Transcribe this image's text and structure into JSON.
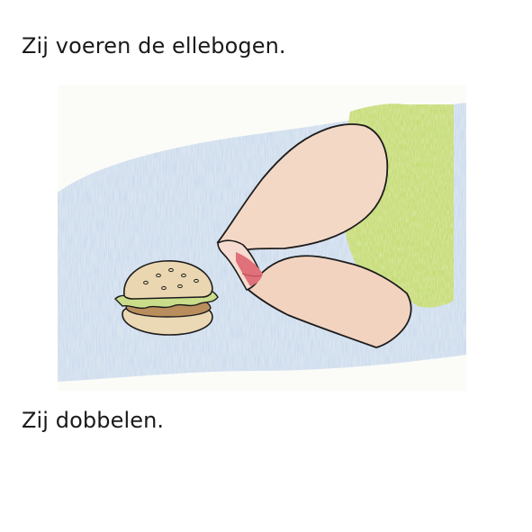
{
  "captions": {
    "top": "Zij voeren de ellebogen.",
    "bottom": "Zij dobbelen."
  },
  "illustration": {
    "depicts": "elbows-eating-hamburger",
    "colors": {
      "background_wash": "#c9d7ea",
      "skin": "#f3d6c4",
      "sleeve": "#c7dc7a",
      "mouth": "#e06a73",
      "bun": "#e9d5ae",
      "lettuce": "#c9dc8c",
      "patty": "#b38a5c",
      "outline": "#1c1c1c"
    }
  }
}
